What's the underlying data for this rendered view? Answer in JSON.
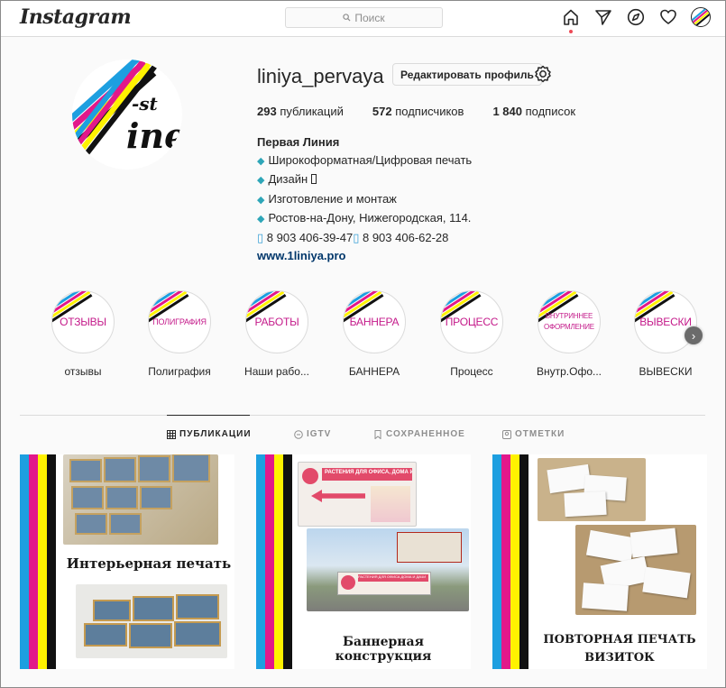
{
  "nav": {
    "logo": "Instagram",
    "search_placeholder": "Поиск",
    "icons": [
      "home-icon",
      "direct-icon",
      "explore-icon",
      "activity-icon",
      "profile-avatar"
    ]
  },
  "profile": {
    "username": "liniya_pervaya",
    "edit_label": "Редактировать профиль",
    "posts_count": "293",
    "posts_label": " публикаций",
    "followers_count": "572",
    "followers_label": " подписчиков",
    "following_count": "1 840",
    "following_label": " подписок",
    "full_name": "Первая Линия",
    "bio_lines": [
      "Широкоформатная/Цифровая печать",
      "Дизайн ",
      "Изготовление и монтаж",
      "Ростов-на-Дону, Нижегородская, 114."
    ],
    "phone1": "8 903 406-39-47",
    "phone2": "8 903 406-62-28",
    "website": "www.1liniya.pro",
    "logo_text_top": "-st",
    "logo_text_main": "ine"
  },
  "highlights": [
    {
      "circle_text": "ОТЗЫВЫ",
      "label": "отзывы"
    },
    {
      "circle_text": "ПОЛИГРАФИЯ",
      "label": "Полиграфия"
    },
    {
      "circle_text": "РАБОТЫ",
      "label": "Наши рабо..."
    },
    {
      "circle_text": "БАННЕРА",
      "label": "БАННЕРА"
    },
    {
      "circle_text": "ПРОЦЕСС",
      "label": "Процесс"
    },
    {
      "circle_text": "ВНУТРИННЕЕ ОФОРМЛЕНИЕ",
      "label": "Внутр.Офо..."
    },
    {
      "circle_text": "ВЫВЕСКИ",
      "label": "ВЫВЕСКИ"
    }
  ],
  "tabs": {
    "posts": "ПУБЛИКАЦИИ",
    "igtv": "IGTV",
    "saved": "СОХРАНЕННОЕ",
    "tagged": "ОТМЕТКИ"
  },
  "posts": [
    {
      "caption": "Интерьерная печать"
    },
    {
      "caption": "Баннерная конструкция",
      "banner_text": "РАСТЕНИЯ ДЛЯ ОФИСА, ДОМА И ДАЧИ",
      "banner_text2": "РАСТЕНИЯ ДЛЯ ОФИСА ДОМА И ДАЧИ"
    },
    {
      "caption_line1": "ПОВТОРНАЯ ПЕЧАТЬ",
      "caption_line2": "ВИЗИТОК"
    }
  ],
  "colors": {
    "cyan": "#1d9fe0",
    "magenta": "#e2188a",
    "yellow": "#fff200",
    "black": "#111111",
    "highlight_text": "#c41a8a"
  }
}
